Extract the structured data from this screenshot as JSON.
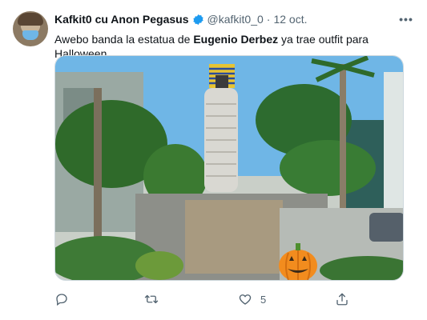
{
  "tweet": {
    "display_name": "Kafkit0 cu Anon Pegasus",
    "handle": "@kafkit0_0",
    "separator": "·",
    "date": "12 oct.",
    "text_before": "Awebo banda la estatua de ",
    "text_bold": "Eugenio Derbez",
    "text_after": " ya trae outfit para Halloween"
  },
  "actions": {
    "reply_count": "",
    "retweet_count": "",
    "like_count": "5"
  },
  "icons": {
    "verified": "verified-badge-icon",
    "more": "more-icon",
    "reply": "reply-icon",
    "retweet": "retweet-icon",
    "like": "heart-icon",
    "share": "share-icon"
  },
  "colors": {
    "verified": "#1d9bf0",
    "muted": "#536471"
  }
}
